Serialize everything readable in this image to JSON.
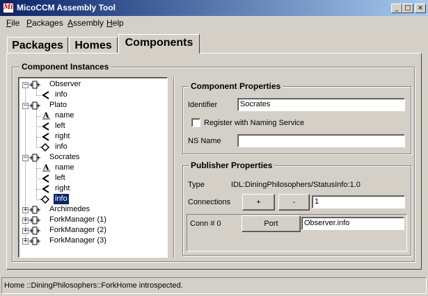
{
  "window": {
    "title": "MicoCCM Assembly Tool",
    "app_icon": "Mi",
    "controls": [
      "_",
      "□",
      "×"
    ]
  },
  "menu": [
    {
      "label": "File",
      "mnemonic": "F",
      "rest": "ile"
    },
    {
      "label": "Packages",
      "mnemonic": "P",
      "rest": "ackages"
    },
    {
      "label": "Assembly",
      "mnemonic": "A",
      "rest": "ssembly"
    },
    {
      "label": "Help",
      "mnemonic": "H",
      "rest": "elp"
    }
  ],
  "tabs": [
    {
      "label": "Packages",
      "active": false
    },
    {
      "label": "Homes",
      "active": false
    },
    {
      "label": "Components",
      "active": true
    }
  ],
  "instances": {
    "title": "Component Instances",
    "tree": [
      {
        "label": "Observer",
        "type": "component",
        "expanded": true
      },
      {
        "label": "info",
        "type": "receptacle"
      },
      {
        "label": "Plato",
        "type": "component",
        "expanded": true
      },
      {
        "label": "name",
        "type": "attribute"
      },
      {
        "label": "left",
        "type": "receptacle"
      },
      {
        "label": "right",
        "type": "receptacle"
      },
      {
        "label": "info",
        "type": "publisher"
      },
      {
        "label": "Socrates",
        "type": "component",
        "expanded": true
      },
      {
        "label": "name",
        "type": "attribute"
      },
      {
        "label": "left",
        "type": "receptacle"
      },
      {
        "label": "right",
        "type": "receptacle"
      },
      {
        "label": "info",
        "type": "publisher",
        "selected": true
      },
      {
        "label": "Archimedes",
        "type": "component",
        "expanded": false
      },
      {
        "label": "ForkManager (1)",
        "type": "component",
        "expanded": false
      },
      {
        "label": "ForkManager (2)",
        "type": "component",
        "expanded": false
      },
      {
        "label": "ForkManager (3)",
        "type": "component",
        "expanded": false
      }
    ]
  },
  "component_properties": {
    "title": "Component Properties",
    "identifier_label": "Identifier",
    "identifier_value": "Socrates",
    "register_label": "Register with Naming Service",
    "register_checked": false,
    "ns_name_label": "NS Name",
    "ns_name_value": ""
  },
  "publisher_properties": {
    "title": "Publisher Properties",
    "type_label": "Type",
    "type_value": "IDL:DiningPhilosophers/StatusInfo:1.0",
    "connections_label": "Connections",
    "add_label": "+",
    "remove_label": "-",
    "connections_value": "1",
    "conn_label": "Conn # 0",
    "port_label": "Port",
    "conn_value": "Observer.info"
  },
  "status": "Home ::DiningPhilosophers::ForkHome introspected.",
  "colors": {
    "titlebar_start": "#0a246a",
    "titlebar_end": "#a6caf0",
    "face": "#d4d0c8",
    "selection": "#0a246a"
  }
}
